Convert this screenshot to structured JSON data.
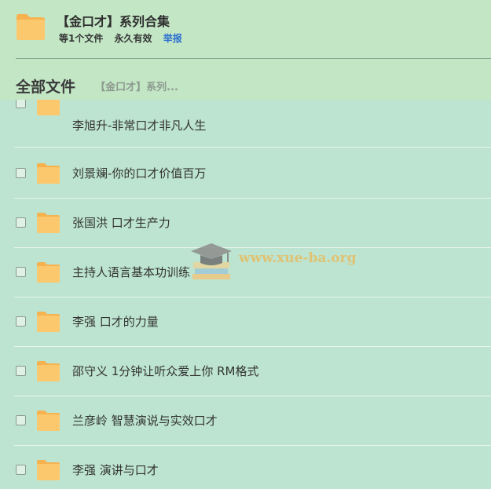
{
  "share": {
    "title": "【金口才】系列合集",
    "meta": {
      "count": "等1个文件",
      "validity": "永久有效",
      "report": "举报"
    }
  },
  "breadcrumb": {
    "root": "全部文件",
    "current": "【金口才】系列..."
  },
  "files": [
    {
      "name": "李旭升-非常口才非凡人生",
      "icon": "folder-icon"
    },
    {
      "name": "刘景斓-你的口才价值百万",
      "icon": "folder-icon"
    },
    {
      "name": "张国洪 口才生产力",
      "icon": "folder-icon"
    },
    {
      "name": "主持人语言基本功训练",
      "icon": "folder-icon"
    },
    {
      "name": "李强 口才的力量",
      "icon": "folder-icon"
    },
    {
      "name": "邵守义 1分钟让听众爱上你 RM格式",
      "icon": "folder-icon"
    },
    {
      "name": "兰彦岭 智慧演说与实效口才",
      "icon": "folder-icon"
    },
    {
      "name": "李强 演讲与口才",
      "icon": "folder-icon"
    }
  ],
  "watermark": {
    "text": "www.xue-ba.org",
    "icon": "graduation-cap-books-icon"
  },
  "colors": {
    "background": "#c3e5c8",
    "list_background": "#bde4d0",
    "folder": "#fbc46d",
    "link": "#2c6fd1"
  }
}
